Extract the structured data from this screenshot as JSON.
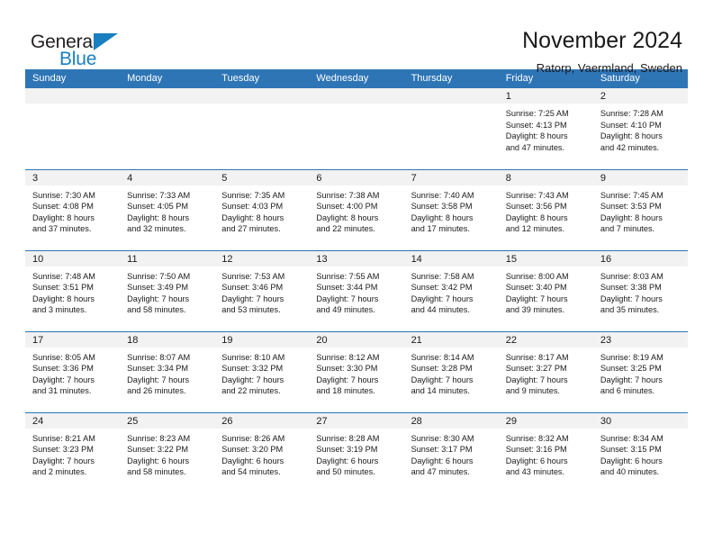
{
  "logo": {
    "word1": "General",
    "word2": "Blue",
    "triangle_color": "#1a7fc1",
    "text_color": "#231f20"
  },
  "header": {
    "title": "November 2024",
    "subtitle": "Ratorp, Vaermland, Sweden"
  },
  "theme": {
    "header_blue": "#2e75b6",
    "daynum_band": "#f2f2f2",
    "text": "#1a1a1a"
  },
  "weekday_headers": [
    "Sunday",
    "Monday",
    "Tuesday",
    "Wednesday",
    "Thursday",
    "Friday",
    "Saturday"
  ],
  "weeks": [
    [
      {
        "blank": true
      },
      {
        "blank": true
      },
      {
        "blank": true
      },
      {
        "blank": true
      },
      {
        "blank": true
      },
      {
        "day": "1",
        "sunrise": "Sunrise: 7:25 AM",
        "sunset": "Sunset: 4:13 PM",
        "daylight1": "Daylight: 8 hours",
        "daylight2": "and 47 minutes."
      },
      {
        "day": "2",
        "sunrise": "Sunrise: 7:28 AM",
        "sunset": "Sunset: 4:10 PM",
        "daylight1": "Daylight: 8 hours",
        "daylight2": "and 42 minutes."
      }
    ],
    [
      {
        "day": "3",
        "sunrise": "Sunrise: 7:30 AM",
        "sunset": "Sunset: 4:08 PM",
        "daylight1": "Daylight: 8 hours",
        "daylight2": "and 37 minutes."
      },
      {
        "day": "4",
        "sunrise": "Sunrise: 7:33 AM",
        "sunset": "Sunset: 4:05 PM",
        "daylight1": "Daylight: 8 hours",
        "daylight2": "and 32 minutes."
      },
      {
        "day": "5",
        "sunrise": "Sunrise: 7:35 AM",
        "sunset": "Sunset: 4:03 PM",
        "daylight1": "Daylight: 8 hours",
        "daylight2": "and 27 minutes."
      },
      {
        "day": "6",
        "sunrise": "Sunrise: 7:38 AM",
        "sunset": "Sunset: 4:00 PM",
        "daylight1": "Daylight: 8 hours",
        "daylight2": "and 22 minutes."
      },
      {
        "day": "7",
        "sunrise": "Sunrise: 7:40 AM",
        "sunset": "Sunset: 3:58 PM",
        "daylight1": "Daylight: 8 hours",
        "daylight2": "and 17 minutes."
      },
      {
        "day": "8",
        "sunrise": "Sunrise: 7:43 AM",
        "sunset": "Sunset: 3:56 PM",
        "daylight1": "Daylight: 8 hours",
        "daylight2": "and 12 minutes."
      },
      {
        "day": "9",
        "sunrise": "Sunrise: 7:45 AM",
        "sunset": "Sunset: 3:53 PM",
        "daylight1": "Daylight: 8 hours",
        "daylight2": "and 7 minutes."
      }
    ],
    [
      {
        "day": "10",
        "sunrise": "Sunrise: 7:48 AM",
        "sunset": "Sunset: 3:51 PM",
        "daylight1": "Daylight: 8 hours",
        "daylight2": "and 3 minutes."
      },
      {
        "day": "11",
        "sunrise": "Sunrise: 7:50 AM",
        "sunset": "Sunset: 3:49 PM",
        "daylight1": "Daylight: 7 hours",
        "daylight2": "and 58 minutes."
      },
      {
        "day": "12",
        "sunrise": "Sunrise: 7:53 AM",
        "sunset": "Sunset: 3:46 PM",
        "daylight1": "Daylight: 7 hours",
        "daylight2": "and 53 minutes."
      },
      {
        "day": "13",
        "sunrise": "Sunrise: 7:55 AM",
        "sunset": "Sunset: 3:44 PM",
        "daylight1": "Daylight: 7 hours",
        "daylight2": "and 49 minutes."
      },
      {
        "day": "14",
        "sunrise": "Sunrise: 7:58 AM",
        "sunset": "Sunset: 3:42 PM",
        "daylight1": "Daylight: 7 hours",
        "daylight2": "and 44 minutes."
      },
      {
        "day": "15",
        "sunrise": "Sunrise: 8:00 AM",
        "sunset": "Sunset: 3:40 PM",
        "daylight1": "Daylight: 7 hours",
        "daylight2": "and 39 minutes."
      },
      {
        "day": "16",
        "sunrise": "Sunrise: 8:03 AM",
        "sunset": "Sunset: 3:38 PM",
        "daylight1": "Daylight: 7 hours",
        "daylight2": "and 35 minutes."
      }
    ],
    [
      {
        "day": "17",
        "sunrise": "Sunrise: 8:05 AM",
        "sunset": "Sunset: 3:36 PM",
        "daylight1": "Daylight: 7 hours",
        "daylight2": "and 31 minutes."
      },
      {
        "day": "18",
        "sunrise": "Sunrise: 8:07 AM",
        "sunset": "Sunset: 3:34 PM",
        "daylight1": "Daylight: 7 hours",
        "daylight2": "and 26 minutes."
      },
      {
        "day": "19",
        "sunrise": "Sunrise: 8:10 AM",
        "sunset": "Sunset: 3:32 PM",
        "daylight1": "Daylight: 7 hours",
        "daylight2": "and 22 minutes."
      },
      {
        "day": "20",
        "sunrise": "Sunrise: 8:12 AM",
        "sunset": "Sunset: 3:30 PM",
        "daylight1": "Daylight: 7 hours",
        "daylight2": "and 18 minutes."
      },
      {
        "day": "21",
        "sunrise": "Sunrise: 8:14 AM",
        "sunset": "Sunset: 3:28 PM",
        "daylight1": "Daylight: 7 hours",
        "daylight2": "and 14 minutes."
      },
      {
        "day": "22",
        "sunrise": "Sunrise: 8:17 AM",
        "sunset": "Sunset: 3:27 PM",
        "daylight1": "Daylight: 7 hours",
        "daylight2": "and 9 minutes."
      },
      {
        "day": "23",
        "sunrise": "Sunrise: 8:19 AM",
        "sunset": "Sunset: 3:25 PM",
        "daylight1": "Daylight: 7 hours",
        "daylight2": "and 6 minutes."
      }
    ],
    [
      {
        "day": "24",
        "sunrise": "Sunrise: 8:21 AM",
        "sunset": "Sunset: 3:23 PM",
        "daylight1": "Daylight: 7 hours",
        "daylight2": "and 2 minutes."
      },
      {
        "day": "25",
        "sunrise": "Sunrise: 8:23 AM",
        "sunset": "Sunset: 3:22 PM",
        "daylight1": "Daylight: 6 hours",
        "daylight2": "and 58 minutes."
      },
      {
        "day": "26",
        "sunrise": "Sunrise: 8:26 AM",
        "sunset": "Sunset: 3:20 PM",
        "daylight1": "Daylight: 6 hours",
        "daylight2": "and 54 minutes."
      },
      {
        "day": "27",
        "sunrise": "Sunrise: 8:28 AM",
        "sunset": "Sunset: 3:19 PM",
        "daylight1": "Daylight: 6 hours",
        "daylight2": "and 50 minutes."
      },
      {
        "day": "28",
        "sunrise": "Sunrise: 8:30 AM",
        "sunset": "Sunset: 3:17 PM",
        "daylight1": "Daylight: 6 hours",
        "daylight2": "and 47 minutes."
      },
      {
        "day": "29",
        "sunrise": "Sunrise: 8:32 AM",
        "sunset": "Sunset: 3:16 PM",
        "daylight1": "Daylight: 6 hours",
        "daylight2": "and 43 minutes."
      },
      {
        "day": "30",
        "sunrise": "Sunrise: 8:34 AM",
        "sunset": "Sunset: 3:15 PM",
        "daylight1": "Daylight: 6 hours",
        "daylight2": "and 40 minutes."
      }
    ]
  ]
}
